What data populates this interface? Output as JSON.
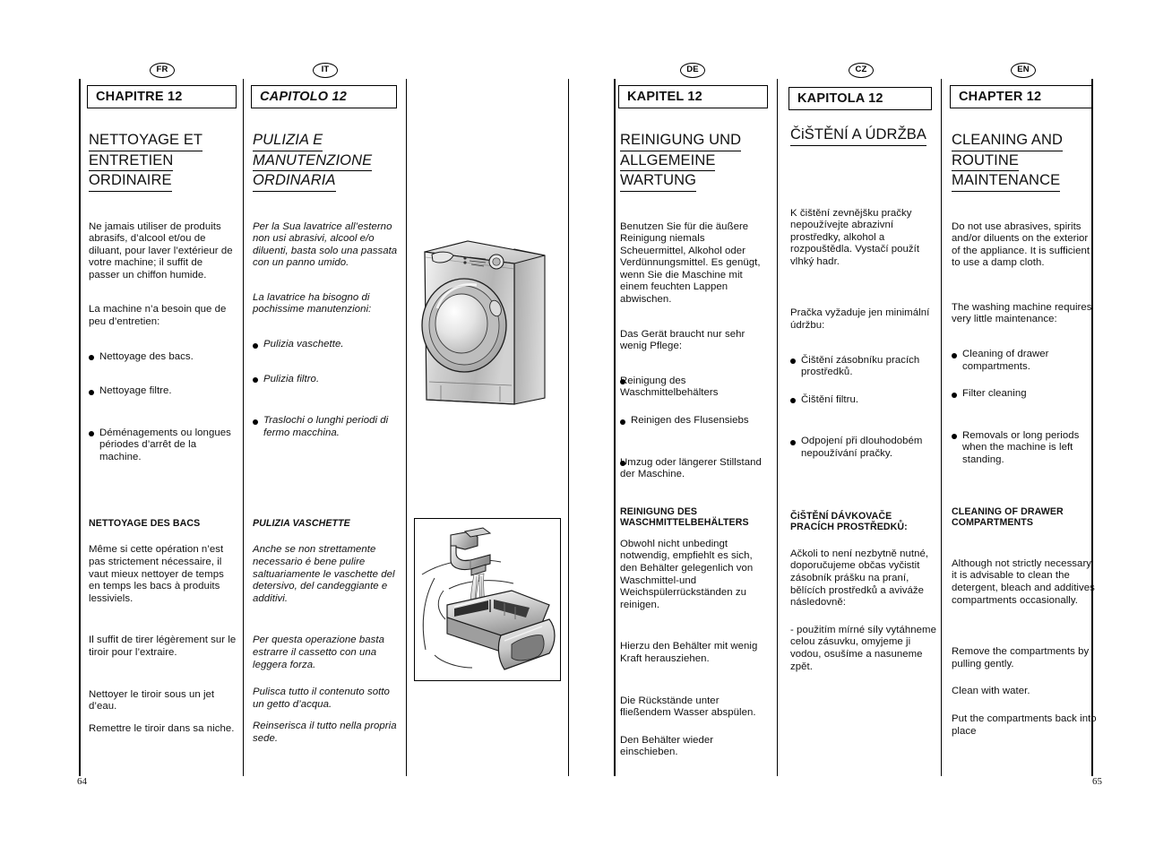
{
  "document": {
    "chapter_number": "12",
    "page_left": "64",
    "page_right": "65"
  },
  "columns": [
    {
      "badge": "FR",
      "chapter_label": "CHAPITRE 12",
      "title": [
        "NETTOYAGE ET",
        "ENTRETIEN",
        "ORDINAIRE"
      ],
      "paras": [
        "Ne jamais utiliser de produits abrasifs, d’alcool et/ou de diluant, pour laver l’extérieur de votre machine; il suffit de passer un chiffon humide.",
        "La machine n’a besoin que de peu d’entretien:"
      ],
      "bullets": [
        "Nettoyage des bacs.",
        "Nettoyage filtre.",
        "Déménagements ou longues périodes d’arrêt de la machine."
      ],
      "subheading": "NETTOYAGE DES BACS",
      "sub_paras": [
        "Même si cette opération n’est pas strictement nécessaire, il vaut mieux nettoyer de temps en temps les bacs à produits lessiviels.",
        "Il suffit de tirer légèrement sur le tiroir pour l’extraire.",
        "Nettoyer le tiroir sous un jet d’eau.",
        "Remettre le tiroir dans sa niche."
      ]
    },
    {
      "badge": "IT",
      "chapter_label": "CAPITOLO 12",
      "title": [
        "PULIZIA E",
        "MANUTENZIONE",
        "ORDINARIA"
      ],
      "paras": [
        "Per la Sua lavatrice all’esterno non usi abrasivi, alcool e/o diluenti, basta solo una passata con un panno umido.",
        "La lavatrice ha bisogno di pochissime manutenzioni:"
      ],
      "bullets": [
        "Pulizia vaschette.",
        "Pulizia filtro.",
        "Traslochi o lunghi periodi di fermo macchina."
      ],
      "subheading": "PULIZIA VASCHETTE",
      "sub_paras": [
        "Anche se non strettamente necessario é bene pulire saltuariamente le vaschette del detersivo, del candeggiante e additivi.",
        "Per questa operazione basta estrarre il cassetto con una leggera forza.",
        "Pulisca tutto il contenuto sotto un getto d’acqua.",
        "Reinserisca il tutto nella propria sede."
      ]
    },
    {
      "badge": "DE",
      "chapter_label": "KAPITEL 12",
      "title": [
        "REINIGUNG UND",
        "ALLGEMEINE",
        "WARTUNG"
      ],
      "paras": [
        "Benutzen Sie für die äußere Reinigung niemals Scheuermittel, Alkohol oder Verdünnungsmittel. Es genügt, wenn Sie die Maschine mit einem feuchten Lappen abwischen.",
        "Das Gerät braucht nur sehr wenig Pflege:"
      ],
      "bullets": [
        "Reinigung des Waschmittelbehälters",
        "Reinigen des Flusensiebs",
        "Umzug oder längerer Stillstand der Maschine."
      ],
      "subheading": "REINIGUNG DES\nWASCHMITTELBEHÄLTERS",
      "sub_paras": [
        "Obwohl nicht unbedingt notwendig, empfiehlt es sich, den Behälter gelegenlich von Waschmittel-und Weichspülerrückständen zu reinigen.",
        "Hierzu den Behälter mit wenig Kraft herausziehen.",
        "Die Rückstände unter fließendem Wasser abspülen.",
        "Den Behälter wieder einschieben."
      ]
    },
    {
      "badge": "CZ",
      "chapter_label": "KAPITOLA 12",
      "title": [
        "ČiŠTĚNÍ A ÚDRŽBA"
      ],
      "paras": [
        "K čištění zevnějšku pračky nepoužívejte abrazivní prostředky, alkohol a rozpouštědla. Vystačí použít vlhký hadr.",
        "Pračka vyžaduje jen minimální údržbu:"
      ],
      "bullets": [
        "Čištění zásobníku  pracích prostředků.",
        "Čištění filtru.",
        "Odpojení při dlouhodobém nepoužívání pračky."
      ],
      "subheading": "ČiŠTĚNÍ DÁVKOVAČE\nPRACÍCH PROSTŘEDKŮ:",
      "sub_paras": [
        "Ačkoli to není nezbytně nutné, doporučujeme občas vyčistit zásobník  prášku na praní, bělících prostředků a aviváže následovně:",
        "- použitím mírné síly vytáhneme celou zásuvku, omyjeme ji vodou, osušíme a nasuneme zpět."
      ]
    },
    {
      "badge": "EN",
      "chapter_label": "CHAPTER 12",
      "title": [
        "CLEANING AND",
        "ROUTINE",
        "MAINTENANCE"
      ],
      "paras": [
        "Do not use abrasives, spirits and/or diluents on the exterior of the appliance. It is sufficient to use a damp cloth.",
        "The washing machine requires very little maintenance:"
      ],
      "bullets": [
        "Cleaning of drawer compartments.",
        "Filter cleaning",
        "Removals or long periods when the machine is left standing."
      ],
      "subheading": "CLEANING OF DRAWER\nCOMPARTMENTS",
      "sub_paras": [
        "Although not strictly necessary, it is advisable to clean the detergent, bleach and additives compartments occasionally.",
        "Remove the compartments by pulling gently.",
        "Clean with water.",
        "Put the compartments back into place"
      ]
    }
  ],
  "illustrations": [
    {
      "name": "washing-machine",
      "caption": ""
    },
    {
      "name": "detergent-drawer-rinsing",
      "caption": ""
    }
  ]
}
